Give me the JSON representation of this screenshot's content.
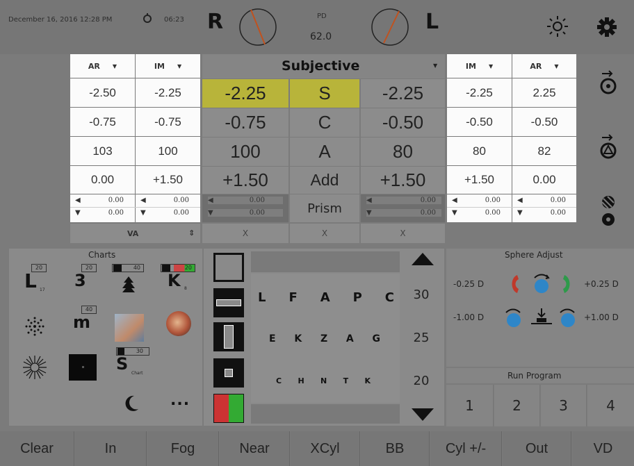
{
  "topbar": {
    "datetime": "December 16, 2016  12:28 PM",
    "timer": "06:23",
    "right_label": "R",
    "left_label": "L",
    "pd_label": "PD",
    "pd_value": "62.0"
  },
  "right_eye": {
    "col_ar": "AR",
    "col_im": "IM",
    "ar": [
      "-2.50",
      "-0.75",
      "103",
      "0.00"
    ],
    "im": [
      "-2.25",
      "-0.75",
      "100",
      "+1.50"
    ],
    "prism_ar": [
      "0.00",
      "0.00"
    ],
    "prism_im": [
      "0.00",
      "0.00"
    ],
    "va_label": "VA"
  },
  "subjective": {
    "title": "Subjective",
    "labels": [
      "S",
      "C",
      "A",
      "Add",
      "Prism"
    ],
    "right": [
      "-2.25",
      "-0.75",
      "100",
      "+1.50"
    ],
    "left": [
      "-2.25",
      "-0.50",
      "80",
      "+1.50"
    ],
    "prism_right": [
      "0.00",
      "0.00"
    ],
    "prism_left": [
      "0.00",
      "0.00"
    ],
    "x_marks": [
      "X",
      "X",
      "X"
    ]
  },
  "left_eye": {
    "col_im": "IM",
    "col_ar": "AR",
    "im": [
      "-2.25",
      "-0.50",
      "80",
      "+1.50"
    ],
    "ar": [
      "2.25",
      "-0.50",
      "82",
      "0.00"
    ],
    "prism_im": [
      "0.00",
      "0.00"
    ],
    "prism_ar": [
      "0.00",
      "0.00"
    ]
  },
  "charts": {
    "title": "Charts",
    "badges": [
      "20",
      "20",
      "40",
      "20",
      "40",
      "30"
    ],
    "chars": [
      "L",
      "3",
      "K",
      "m",
      "S"
    ],
    "subs": [
      "17",
      "8",
      "Chart"
    ],
    "more": "..."
  },
  "acuity": {
    "rows": [
      [
        "L",
        "F",
        "A",
        "P",
        "C"
      ],
      [
        "E",
        "K",
        "Z",
        "A",
        "G"
      ],
      [
        "C",
        "H",
        "N",
        "T",
        "K"
      ]
    ],
    "sizes": [
      "30",
      "25",
      "20"
    ]
  },
  "sphere_adjust": {
    "title": "Sphere Adjust",
    "minus_small": "-0.25 D",
    "plus_small": "+0.25 D",
    "minus_big": "-1.00 D",
    "plus_big": "+1.00 D"
  },
  "run_program": {
    "title": "Run Program",
    "steps": [
      "1",
      "2",
      "3",
      "4"
    ]
  },
  "buttons": [
    "Clear",
    "In",
    "Fog",
    "Near",
    "XCyl",
    "BB",
    "Cyl +/-",
    "Out",
    "VD"
  ],
  "colors": {
    "highlight": "#b8b43a",
    "panel_white": "#fbfbfb",
    "bar_gray": "#767676",
    "red": "#c0392b",
    "green": "#2e9a4a",
    "blue": "#2e86c8"
  }
}
